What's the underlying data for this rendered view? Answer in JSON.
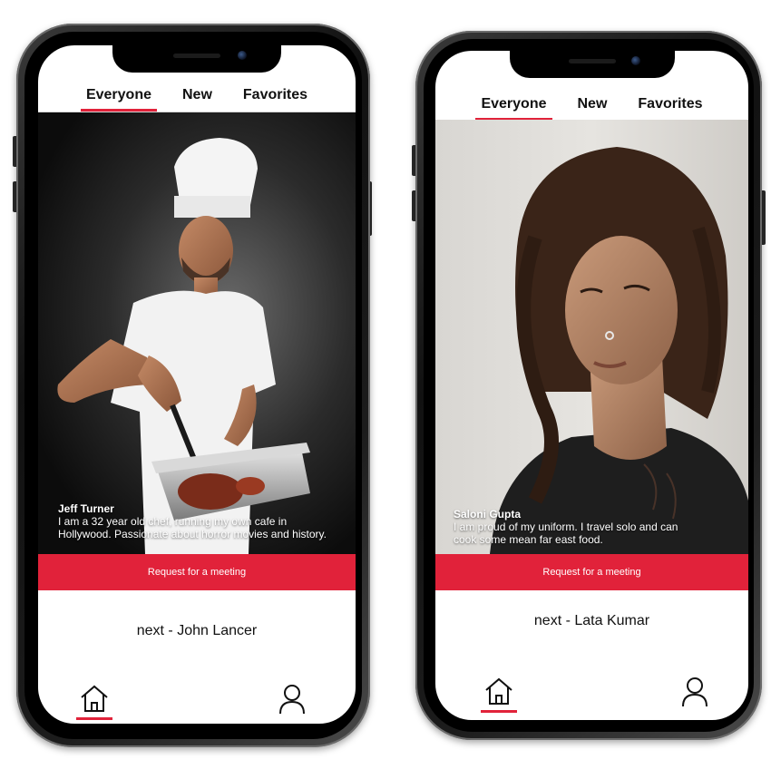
{
  "colors": {
    "accent": "#e1223a",
    "phone_frame": "#111111",
    "screen_bg": "#ffffff"
  },
  "phones": [
    {
      "tabs": [
        {
          "label": "Everyone",
          "active": true
        },
        {
          "label": "New",
          "active": false
        },
        {
          "label": "Favorites",
          "active": false
        }
      ],
      "profile": {
        "name": "Jeff Turner",
        "bio_line1": "I am a 32 year old chef, running my own cafe in",
        "bio_line2": "Hollywood. Passionate about horror movies and history.",
        "photo": "chef with white hat carving roast"
      },
      "cta_label": "Request for a meeting",
      "next_label": "next - John Lancer",
      "bottom_nav": [
        {
          "icon": "home-icon",
          "active": true
        },
        {
          "icon": "user-icon",
          "active": false
        }
      ]
    },
    {
      "tabs": [
        {
          "label": "Everyone",
          "active": true
        },
        {
          "label": "New",
          "active": false
        },
        {
          "label": "Favorites",
          "active": false
        }
      ],
      "profile": {
        "name": "Saloni Gupta",
        "bio_line1": "I  am  proud of my uniform. I travel solo and can",
        "bio_line2": "cook some mean far east food.",
        "photo": "woman with curly hair and nose ring"
      },
      "cta_label": "Request for a meeting",
      "next_label": "next - Lata Kumar",
      "bottom_nav": [
        {
          "icon": "home-icon",
          "active": true
        },
        {
          "icon": "user-icon",
          "active": false
        }
      ]
    }
  ]
}
